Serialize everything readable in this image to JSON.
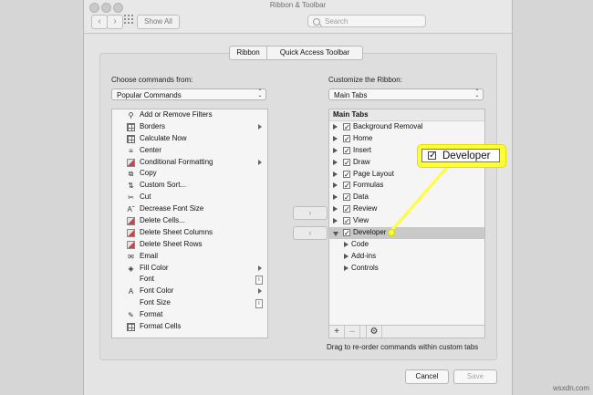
{
  "window": {
    "title": "Ribbon & Toolbar",
    "show_all": "Show All",
    "search_placeholder": "Search",
    "back": "‹",
    "forward": "›"
  },
  "tabs": [
    "Ribbon",
    "Quick Access Toolbar"
  ],
  "left": {
    "label": "Choose commands from:",
    "select_value": "Popular Commands",
    "commands": [
      {
        "label": "Add or Remove Filters",
        "icon": "filter-icon",
        "glyph": "⚲",
        "submenu": false
      },
      {
        "label": "Borders",
        "icon": "borders-icon",
        "glyph": "",
        "submenu": true
      },
      {
        "label": "Calculate Now",
        "icon": "calculator-icon",
        "glyph": "",
        "submenu": false
      },
      {
        "label": "Center",
        "icon": "center-align-icon",
        "glyph": "≡",
        "submenu": false
      },
      {
        "label": "Conditional Formatting",
        "icon": "conditional-formatting-icon",
        "glyph": "",
        "submenu": true
      },
      {
        "label": "Copy",
        "icon": "copy-icon",
        "glyph": "⧉",
        "submenu": false
      },
      {
        "label": "Custom Sort...",
        "icon": "sort-icon",
        "glyph": "⇅",
        "submenu": false
      },
      {
        "label": "Cut",
        "icon": "scissors-icon",
        "glyph": "✂",
        "submenu": false
      },
      {
        "label": "Decrease Font Size",
        "icon": "decrease-font-icon",
        "glyph": "Aˇ",
        "submenu": false
      },
      {
        "label": "Delete Cells...",
        "icon": "delete-cells-icon",
        "glyph": "",
        "submenu": false
      },
      {
        "label": "Delete Sheet Columns",
        "icon": "delete-columns-icon",
        "glyph": "",
        "submenu": false
      },
      {
        "label": "Delete Sheet Rows",
        "icon": "delete-rows-icon",
        "glyph": "",
        "submenu": false
      },
      {
        "label": "Email",
        "icon": "email-icon",
        "glyph": "✉",
        "submenu": false
      },
      {
        "label": "Fill Color",
        "icon": "fill-color-icon",
        "glyph": "◈",
        "submenu": true
      },
      {
        "label": "Font",
        "icon": "font-icon",
        "glyph": "",
        "submenu": false,
        "box": "I"
      },
      {
        "label": "Font Color",
        "icon": "font-color-icon",
        "glyph": "A",
        "submenu": true
      },
      {
        "label": "Font Size",
        "icon": "font-size-icon",
        "glyph": "",
        "submenu": false,
        "box": "I"
      },
      {
        "label": "Format",
        "icon": "format-painter-icon",
        "glyph": "✎",
        "submenu": false
      },
      {
        "label": "Format Cells",
        "icon": "format-cells-icon",
        "glyph": "",
        "submenu": false
      }
    ]
  },
  "right": {
    "label": "Customize the Ribbon:",
    "select_value": "Main Tabs",
    "header": "Main Tabs",
    "tabs": [
      {
        "label": "Background Removal",
        "level": 0,
        "checked": true,
        "expanded": false
      },
      {
        "label": "Home",
        "level": 0,
        "checked": true,
        "expanded": false
      },
      {
        "label": "Insert",
        "level": 0,
        "checked": true,
        "expanded": false
      },
      {
        "label": "Draw",
        "level": 0,
        "checked": true,
        "expanded": false
      },
      {
        "label": "Page Layout",
        "level": 0,
        "checked": true,
        "expanded": false
      },
      {
        "label": "Formulas",
        "level": 0,
        "checked": true,
        "expanded": false
      },
      {
        "label": "Data",
        "level": 0,
        "checked": true,
        "expanded": false
      },
      {
        "label": "Review",
        "level": 0,
        "checked": true,
        "expanded": false
      },
      {
        "label": "View",
        "level": 0,
        "checked": true,
        "expanded": false
      },
      {
        "label": "Developer",
        "level": 0,
        "checked": true,
        "expanded": true,
        "selected": true
      },
      {
        "label": "Code",
        "level": 1,
        "checked": false,
        "expanded": false
      },
      {
        "label": "Add-ins",
        "level": 1,
        "checked": false,
        "expanded": false
      },
      {
        "label": "Controls",
        "level": 1,
        "checked": false,
        "expanded": false
      }
    ],
    "add": "+",
    "remove": "–",
    "settings": "⚙",
    "hint": "Drag to re-order commands within custom tabs"
  },
  "move_right": "›",
  "move_left": "‹",
  "buttons": {
    "cancel": "Cancel",
    "save": "Save"
  },
  "callout": {
    "label": "Developer",
    "check": "✓"
  },
  "watermark": "wsxdn.com",
  "colors": {
    "highlight": "#ffff3a"
  }
}
